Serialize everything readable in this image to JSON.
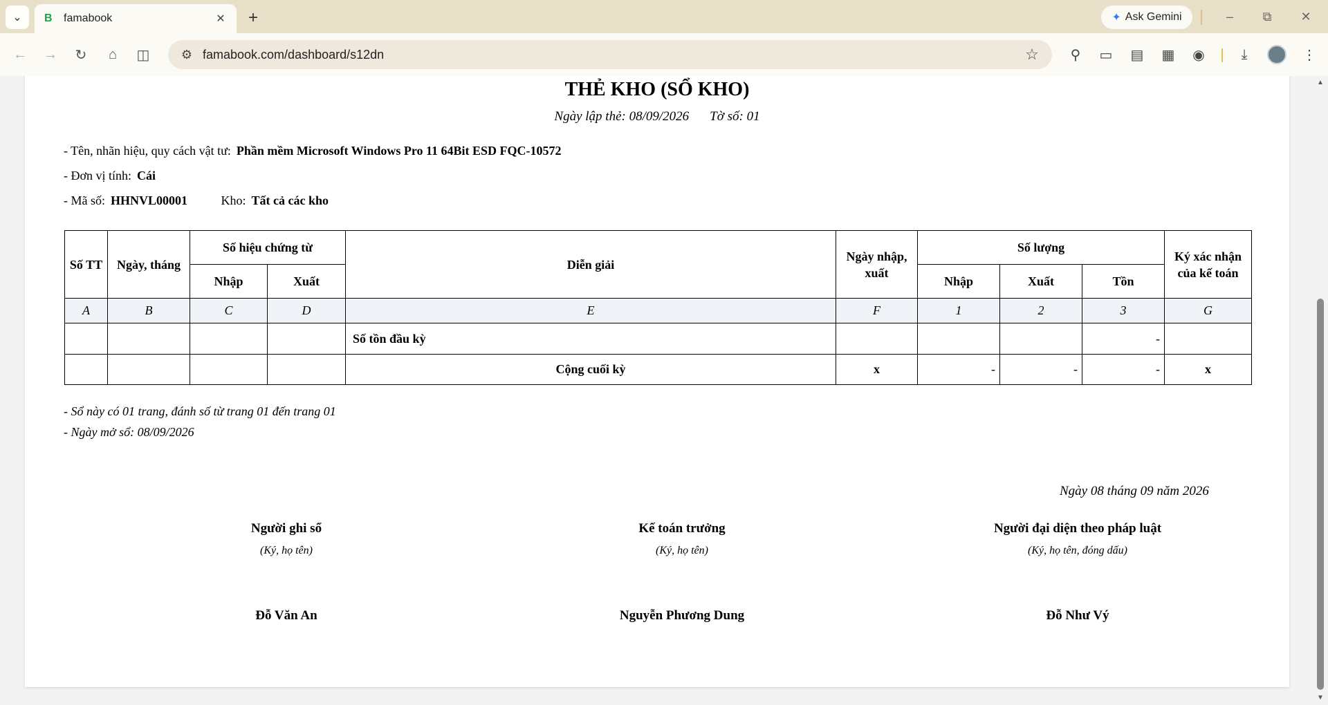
{
  "browser": {
    "tab_title": "famabook",
    "tab_favicon": "B",
    "gemini_label": "Ask Gemini",
    "url": "famabook.com/dashboard/s12dn"
  },
  "doc": {
    "title": "THẺ KHO (SỔ KHO)",
    "date_made": "Ngày lập thẻ: 08/09/2026",
    "sheet_no": "Tờ số: 01",
    "item_label": "- Tên, nhãn hiệu, quy cách vật tư:",
    "item_value": "Phần mềm Microsoft Windows Pro 11 64Bit ESD FQC-10572",
    "unit_label": "- Đơn vị tính:",
    "unit_value": "Cái",
    "code_label": "- Mã số:",
    "code_value": "HHNVL00001",
    "warehouse_label": "Kho:",
    "warehouse_value": "Tất cả các kho"
  },
  "table": {
    "h_stt": "Số TT",
    "h_date": "Ngày, tháng",
    "h_voucher": "Số hiệu chứng từ",
    "h_voucher_in": "Nhập",
    "h_voucher_out": "Xuất",
    "h_desc": "Diễn giải",
    "h_inout_date": "Ngày nhập, xuất",
    "h_qty": "Số lượng",
    "h_qty_in": "Nhập",
    "h_qty_out": "Xuất",
    "h_qty_bal": "Tồn",
    "h_sign": "Ký xác nhận của kế toán",
    "letters": [
      "A",
      "B",
      "C",
      "D",
      "E",
      "F",
      "1",
      "2",
      "3",
      "G"
    ],
    "opening_label": "Số tồn đầu kỳ",
    "opening_balance": "-",
    "closing_label": "Cộng cuối kỳ",
    "closing_date": "x",
    "closing_in": "-",
    "closing_out": "-",
    "closing_bal": "-",
    "closing_sign": "x"
  },
  "notes": {
    "pages": "- Sổ này có 01 trang, đánh số từ trang 01 đến trang 01",
    "open_date": "- Ngày mở sổ: 08/09/2026",
    "sign_date": "Ngày 08 tháng 09 năm 2026"
  },
  "signatures": [
    {
      "title": "Người ghi sổ",
      "hint": "(Ký, họ tên)",
      "name": "Đỗ Văn An"
    },
    {
      "title": "Kế toán trưởng",
      "hint": "(Ký, họ tên)",
      "name": "Nguyễn Phương Dung"
    },
    {
      "title": "Người đại diện theo pháp luật",
      "hint": "(Ký, họ tên, đóng dấu)",
      "name": "Đỗ Như Vý"
    }
  ]
}
